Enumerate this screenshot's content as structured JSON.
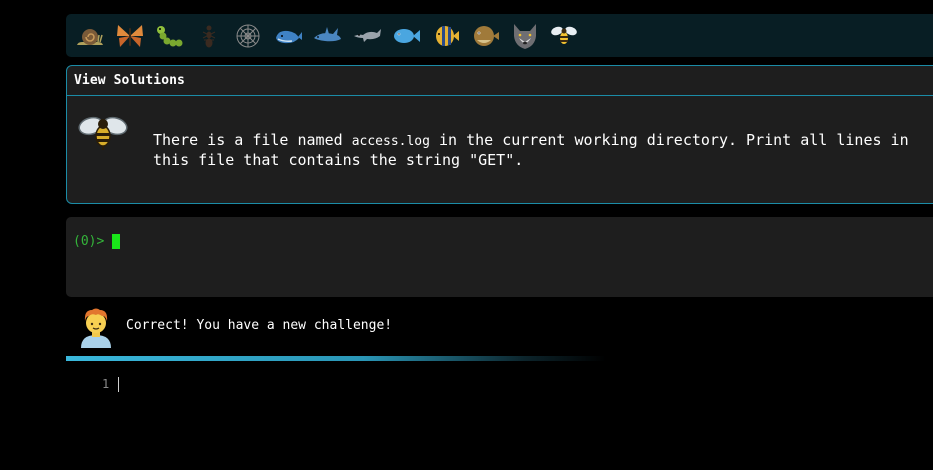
{
  "toolbar": {
    "levels": [
      {
        "icon": "snail-icon"
      },
      {
        "icon": "butterfly-icon"
      },
      {
        "icon": "caterpillar-icon"
      },
      {
        "icon": "ant-icon"
      },
      {
        "icon": "spider-web-icon"
      },
      {
        "icon": "whale-icon"
      },
      {
        "icon": "shark-icon"
      },
      {
        "icon": "dolphin-icon"
      },
      {
        "icon": "fish-icon"
      },
      {
        "icon": "tropical-fish-icon"
      },
      {
        "icon": "pufferfish-icon"
      },
      {
        "icon": "wolf-icon"
      },
      {
        "icon": "bee-icon"
      }
    ]
  },
  "challenge": {
    "header": "View Solutions",
    "text_before": "There is a file named ",
    "file_name": "access.log",
    "text_after": " in the current working directory. Print all lines in\nthis file that contains the string \"GET\".",
    "avatar_icon": "bee-icon"
  },
  "terminal": {
    "prompt": "(0)>"
  },
  "feedback": {
    "avatar_icon": "person-icon",
    "message": "Correct! You have a new challenge!"
  },
  "editor": {
    "line_number": "1"
  },
  "colors": {
    "accent": "#1b8ca7",
    "prompt_green": "#34b53a",
    "cursor_green": "#19e619",
    "panel_bg": "#1e1e1e",
    "iconbar_bg": "#081e24"
  }
}
